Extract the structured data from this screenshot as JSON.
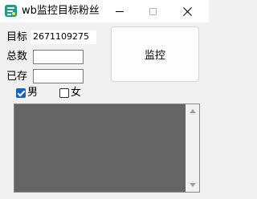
{
  "window": {
    "title": "wb监控目标粉丝"
  },
  "form": {
    "target_label": "目标",
    "target_value": "2671109275",
    "total_label": "总数",
    "total_value": "",
    "saved_label": "已存",
    "saved_value": ""
  },
  "monitor_button": {
    "label": "监控"
  },
  "gender": {
    "male": {
      "label": "男",
      "checked": true
    },
    "female": {
      "label": "女",
      "checked": false
    }
  },
  "colors": {
    "accent": "#1565c0",
    "list_bg": "#656565",
    "icon": "#1f9a83"
  },
  "icons": {
    "app": "app-icon",
    "minimize": "minimize-icon",
    "maximize": "maximize-icon",
    "close": "close-icon"
  }
}
